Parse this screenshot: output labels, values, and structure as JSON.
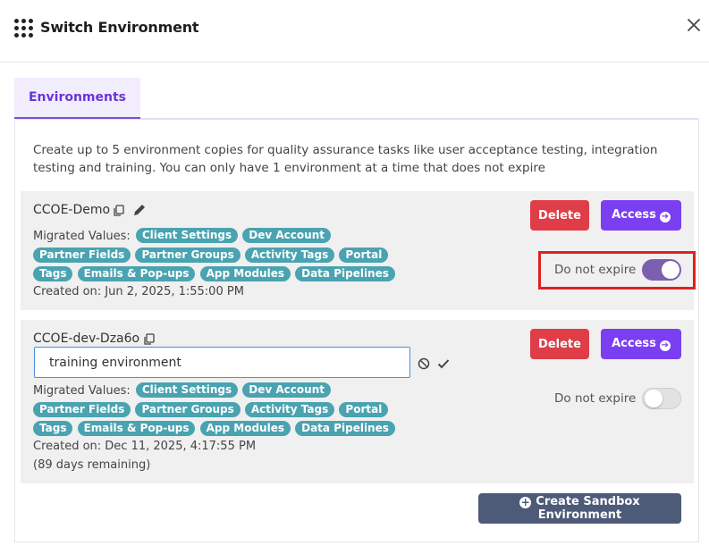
{
  "dialog": {
    "title": "Switch Environment",
    "close_icon": "close-icon",
    "menu_icon": "grid-icon"
  },
  "tabs": [
    {
      "label": "Environments",
      "active": true
    }
  ],
  "description": "Create up to 5 environment copies for quality assurance tasks like user acceptance testing, integration testing and training. You can only have 1 environment at a time that does not expire",
  "environments": [
    {
      "name": "CCOE-Demo",
      "migrated_label": "Migrated Values:",
      "tags": [
        "Client Settings",
        "Dev Account",
        "Partner Fields",
        "Partner Groups",
        "Activity Tags",
        "Portal",
        "Tags",
        "Emails & Pop-ups",
        "App Modules",
        "Data Pipelines"
      ],
      "created": "Created on: Jun 2, 2025, 1:55:00 PM",
      "delete_label": "Delete",
      "access_label": "Access",
      "expire_label": "Do not expire",
      "do_not_expire": true
    },
    {
      "name": "CCOE-dev-Dza6o",
      "description_value": "training environment",
      "migrated_label": "Migrated Values:",
      "tags": [
        "Client Settings",
        "Dev Account",
        "Partner Fields",
        "Partner Groups",
        "Activity Tags",
        "Portal",
        "Tags",
        "Emails & Pop-ups",
        "App Modules",
        "Data Pipelines"
      ],
      "created": "Created on: Dec 11, 2025, 4:17:55 PM",
      "remaining": "(89 days remaining)",
      "delete_label": "Delete",
      "access_label": "Access",
      "expire_label": "Do not expire",
      "do_not_expire": false
    }
  ],
  "create_button_label": "Create Sandbox Environment",
  "colors": {
    "accent": "#7b3ff2",
    "delete": "#df3e48",
    "tag": "#4aa3b0",
    "create": "#4d5a78",
    "highlight": "#e02020"
  }
}
